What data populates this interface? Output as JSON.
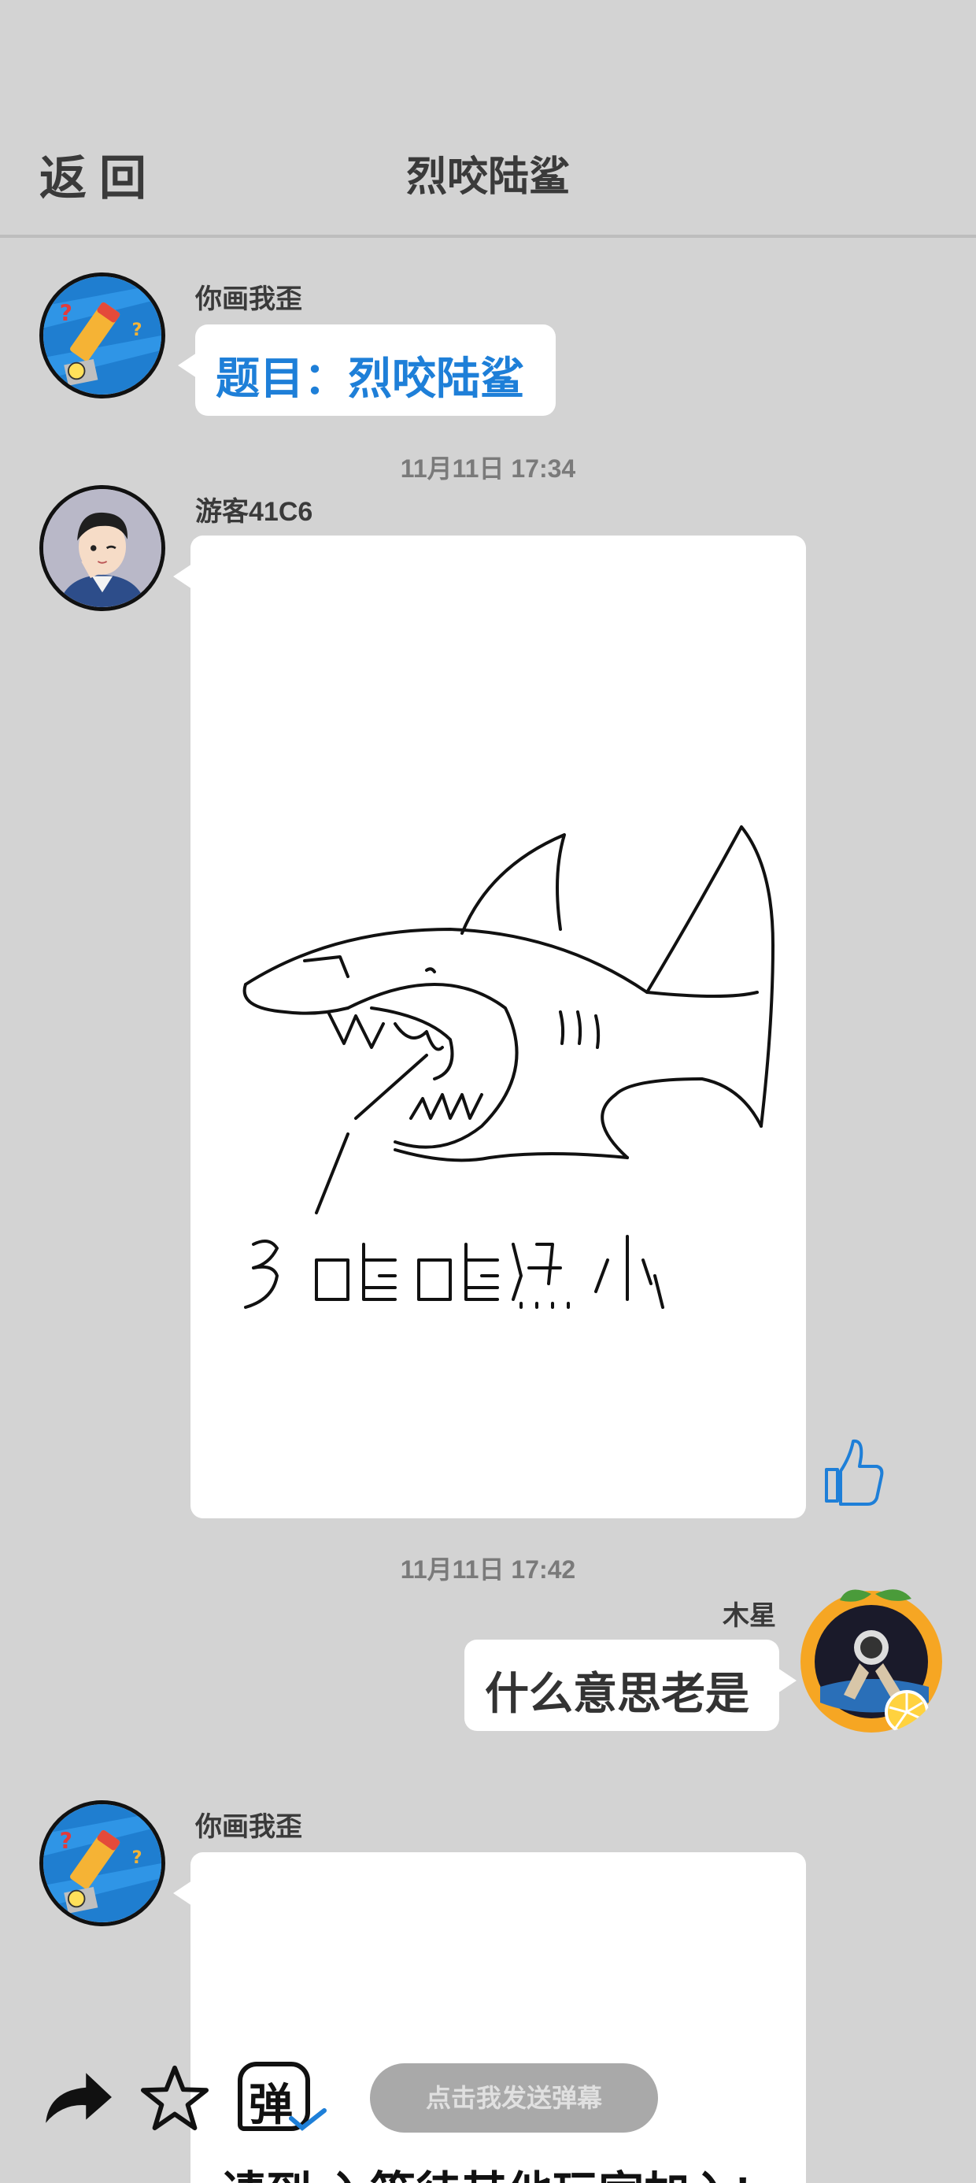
{
  "header": {
    "back_label": "返回",
    "title": "烈咬陆鲨"
  },
  "messages": [
    {
      "sender": "你画我歪",
      "avatar_icon": "pencil-game-avatar",
      "text": "题目：烈咬陆鲨",
      "text_color": "#1e7fd8"
    },
    {
      "timestamp": "11月11日  17:34",
      "sender": "游客41C6",
      "avatar_icon": "cartoon-boy-avatar",
      "drawing_caption": "多喝喝热水"
    },
    {
      "timestamp": "11月11日  17:42",
      "sender": "木星",
      "avatar_icon": "astronaut-orange-avatar",
      "text": "什么意思老是"
    },
    {
      "sender": "你画我歪",
      "avatar_icon": "pencil-game-avatar",
      "partial_text": "请到 入等待其他玩家加入!"
    }
  ],
  "toolbar": {
    "danmaku_icon_label": "弹",
    "danmaku_placeholder": "点击我发送弹幕"
  },
  "colors": {
    "background": "#d3d3d3",
    "bubble": "#ffffff",
    "accent_blue": "#1e7fd8"
  }
}
